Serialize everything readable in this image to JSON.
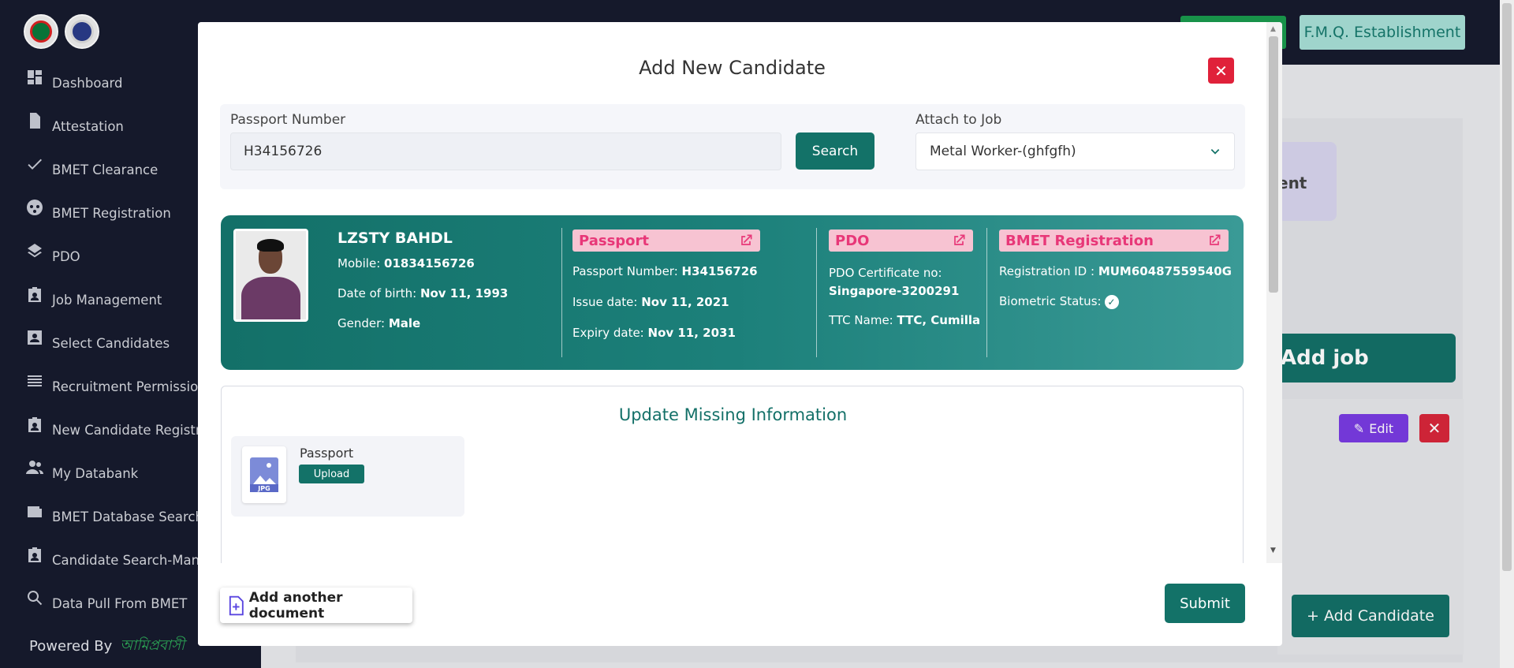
{
  "sidebar": {
    "items": [
      {
        "label": "Dashboard",
        "icon": "dashboard-icon"
      },
      {
        "label": "Attestation",
        "icon": "document-icon"
      },
      {
        "label": "BMET Clearance",
        "icon": "check-icon"
      },
      {
        "label": "BMET Registration",
        "icon": "registration-icon"
      },
      {
        "label": "PDO",
        "icon": "layers-icon"
      },
      {
        "label": "Job Management",
        "icon": "badge-icon"
      },
      {
        "label": "Select Candidates",
        "icon": "profile-card-icon"
      },
      {
        "label": "Recruitment Permission",
        "icon": "list-icon"
      },
      {
        "label": "New Candidate Registration",
        "icon": "badge-icon"
      },
      {
        "label": "My Databank",
        "icon": "people-icon"
      },
      {
        "label": "BMET Database Search",
        "icon": "wallet-icon"
      },
      {
        "label": "Candidate Search-Manual",
        "icon": "badge-icon"
      },
      {
        "label": "Data Pull From BMET",
        "icon": "search-icon"
      }
    ],
    "powered_by": "Powered By",
    "powered_brand": "আমিপ্রবাসী"
  },
  "background": {
    "agency": "F.M.Q. Establishment",
    "card_partial": "ent",
    "add_job": "Add job",
    "edit": "Edit",
    "add_candidate": "+ Add Candidate"
  },
  "modal": {
    "title": "Add New Candidate",
    "passport_label": "Passport Number",
    "passport_value": "H34156726",
    "search_button": "Search",
    "job_label": "Attach to Job",
    "job_value": "Metal Worker-(ghfgfh)",
    "candidate": {
      "name": "LZSTY BAHDL",
      "mobile_label": "Mobile:",
      "mobile": "01834156726",
      "dob_label": "Date of birth:",
      "dob": "Nov 11, 1993",
      "gender_label": "Gender:",
      "gender": "Male"
    },
    "passport_section": {
      "title": "Passport",
      "number_label": "Passport Number:",
      "number": "H34156726",
      "issue_label": "Issue date:",
      "issue": "Nov 11, 2021",
      "expiry_label": "Expiry date:",
      "expiry": "Nov 11, 2031"
    },
    "pdo_section": {
      "title": "PDO",
      "cert_label": "PDO Certificate no:",
      "cert": "Singapore-3200291",
      "ttc_label": "TTC Name:",
      "ttc": "TTC, Cumilla"
    },
    "bmet_section": {
      "title": "BMET Registration",
      "reg_label": "Registration ID :",
      "reg": "MUM60487559540G",
      "bio_label": "Biometric Status:"
    },
    "update_title": "Update Missing Information",
    "document": {
      "name": "Passport",
      "upload": "Upload",
      "type": "JPG"
    },
    "add_document": "Add another document",
    "submit": "Submit"
  },
  "colors": {
    "primary": "#137268",
    "danger": "#e0213a",
    "pill_bg": "#f7c3d2",
    "pill_text": "#e83778"
  }
}
